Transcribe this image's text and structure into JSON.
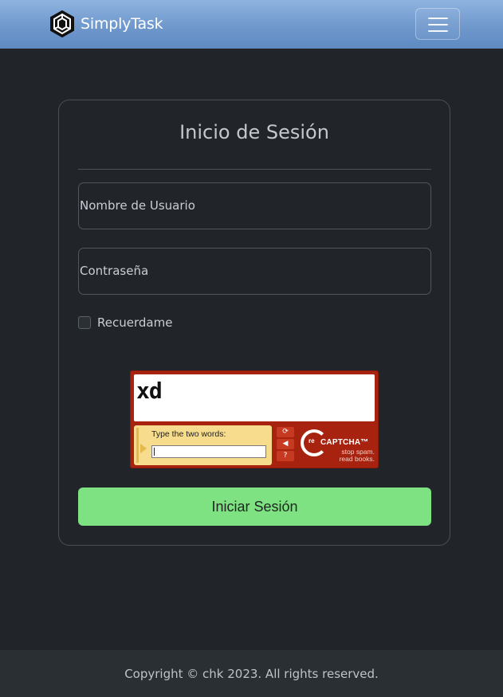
{
  "navbar": {
    "brand": "SimplyTask",
    "logo_icon": "hexagon-logo-icon",
    "menu_icon": "hamburger-menu-icon"
  },
  "login": {
    "title": "Inicio de Sesión",
    "username_label": "Nombre de Usuario",
    "password_label": "Contraseña",
    "remember_label": "Recuerdame",
    "submit_label": "Iniciar Sesión"
  },
  "captcha": {
    "challenge_word": "xd",
    "prompt": "Type the two words:",
    "brand": "CAPTCHA™",
    "brand_prefix": "re",
    "tagline_1": "stop spam.",
    "tagline_2": "read books.",
    "refresh_icon": "refresh-icon",
    "audio_icon": "speaker-icon",
    "help_icon": "help-icon",
    "accent_color": "#a8230f"
  },
  "footer": {
    "copyright": "Copyright © chk 2023. All rights reserved."
  },
  "colors": {
    "background": "#212529",
    "navbar": "#6f98cc",
    "submit": "#7ee282"
  }
}
